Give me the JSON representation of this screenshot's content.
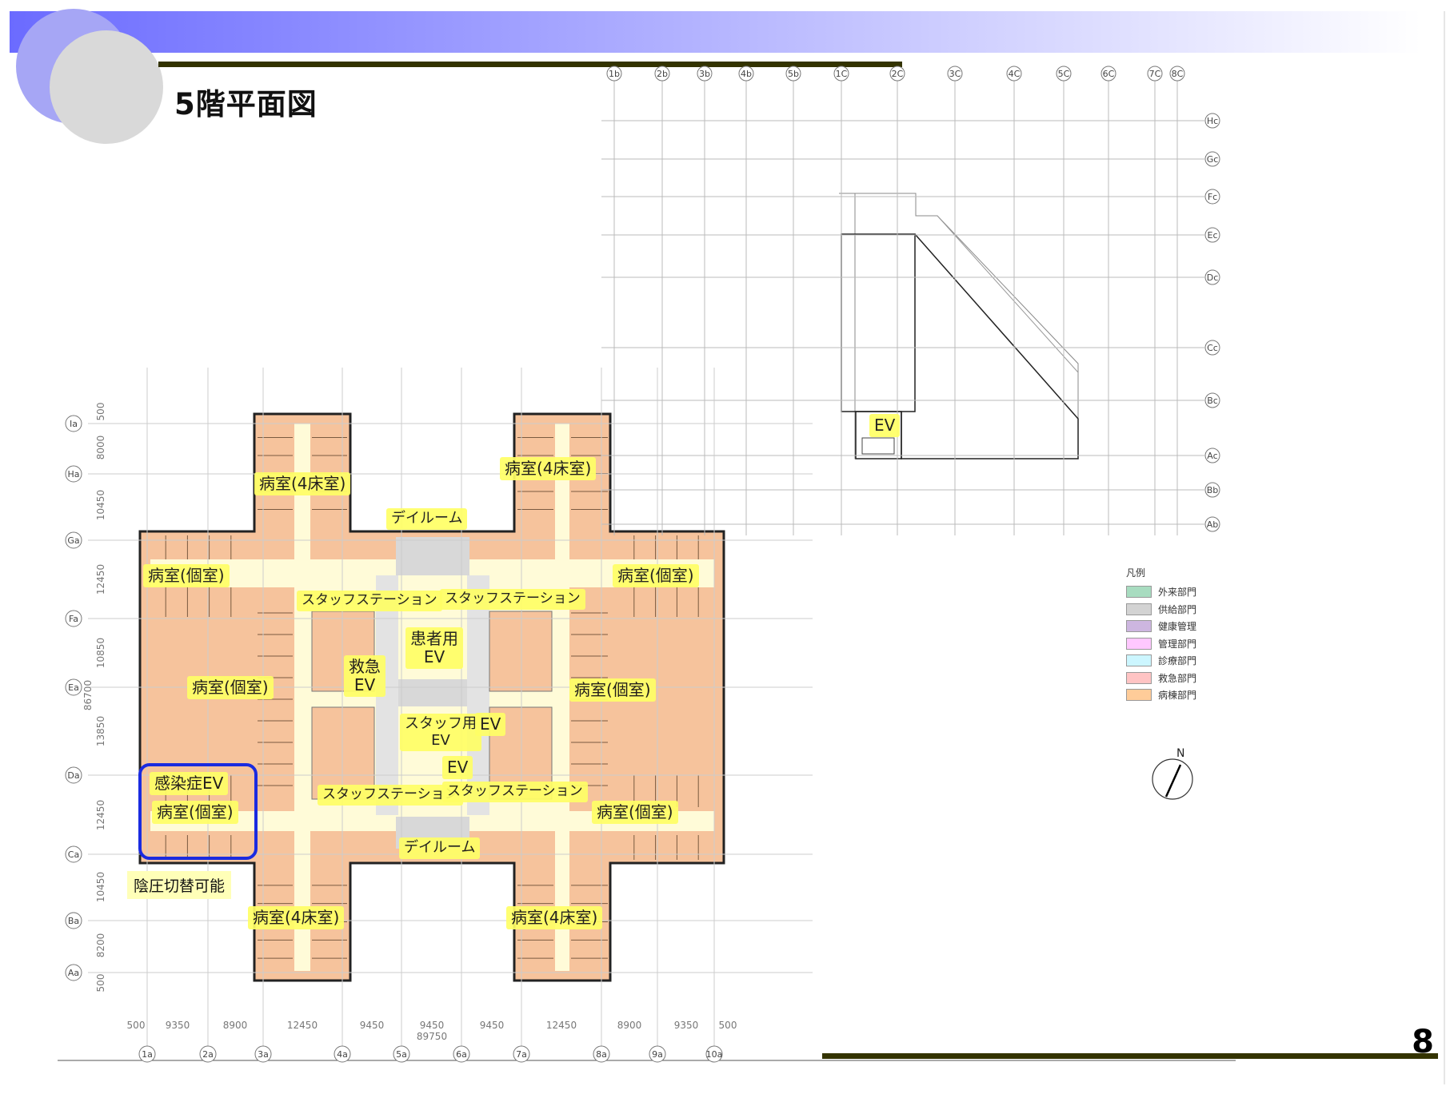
{
  "title": "5階平面図",
  "page_number": "8",
  "labels": {
    "ward4_top_left": "病室(4床室)",
    "ward4_top_right": "病室(4床室)",
    "dayroom_top": "デイルーム",
    "private_left_top": "病室(個室)",
    "private_right_top": "病室(個室)",
    "staff_station_1": "スタッフステーション",
    "staff_station_2": "スタッフステーション",
    "patient_ev": "患者用\nEV",
    "emergency_ev": "救急\nEV",
    "private_left_mid": "病室(個室)",
    "private_right_mid": "病室(個室)",
    "staff_ev": "スタッフ用\nEV",
    "ev_center_right": "EV",
    "ev_center_lower": "EV",
    "infection_ev": "感染症EV",
    "private_left_bottom": "病室(個室)",
    "staff_station_3": "スタッフステーション",
    "staff_station_4": "スタッフステーション",
    "private_right_bottom": "病室(個室)",
    "dayroom_bottom": "デイルーム",
    "negative_pressure": "陰圧切替可能",
    "ward4_bottom_left": "病室(4床室)",
    "ward4_bottom_right": "病室(4床室)",
    "ev_key_plan": "EV"
  },
  "grid_top": [
    "1b",
    "2b",
    "3b",
    "4b",
    "5b",
    "1C",
    "2C",
    "3C",
    "4C",
    "5C",
    "6C",
    "7C",
    "8C"
  ],
  "grid_right": [
    "Hc",
    "Gc",
    "Fc",
    "Ec",
    "Dc",
    "Cc",
    "Bc",
    "Ac",
    "Bb",
    "Ab"
  ],
  "grid_left": [
    "Ia",
    "Ha",
    "Ga",
    "Fa",
    "Ea",
    "Da",
    "Ca",
    "Ba",
    "Aa"
  ],
  "grid_bottom": [
    "1a",
    "2a",
    "3a",
    "4a",
    "5a",
    "6a",
    "7a",
    "8a",
    "9a",
    "10a"
  ],
  "dims_bottom": [
    "500",
    "9350",
    "8900",
    "12450",
    "9450",
    "9450",
    "9450",
    "12450",
    "8900",
    "9350",
    "500"
  ],
  "dim_total_bottom": "89750",
  "dims_left": [
    "500",
    "8000",
    "10450",
    "12450",
    "10850",
    "13850",
    "12450",
    "10450",
    "8200",
    "500"
  ],
  "dim_total_left": "86700",
  "legend": {
    "title": "凡例",
    "items": [
      {
        "label": "外来部門",
        "color": "#a8dcc0"
      },
      {
        "label": "供給部門",
        "color": "#d3d3d3"
      },
      {
        "label": "健康管理",
        "color": "#cdb6e0"
      },
      {
        "label": "管理部門",
        "color": "#ffc8ff"
      },
      {
        "label": "診療部門",
        "color": "#ccf6ff"
      },
      {
        "label": "救急部門",
        "color": "#ffc4c4"
      },
      {
        "label": "病棟部門",
        "color": "#ffcc99"
      }
    ]
  },
  "north": "N",
  "colors": {
    "header_gradient_start": "#6b6bff",
    "header_gradient_end": "#ffffff",
    "rule_dark": "#333300",
    "ward_fill": "#f6c39c",
    "corridor_fill": "#fffbd8",
    "core_fill": "#d8d8d8",
    "highlight": "#ffff66",
    "infection_frame": "#1a2be0"
  }
}
